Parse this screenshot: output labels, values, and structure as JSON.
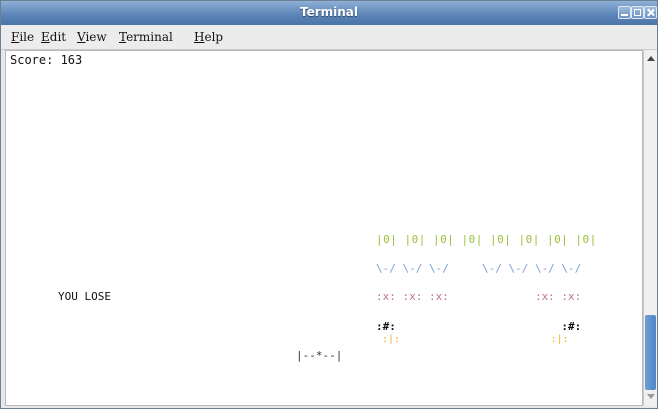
{
  "window": {
    "title": "Terminal"
  },
  "menu": {
    "items": [
      "File",
      "Edit",
      "View",
      "Terminal",
      "Help"
    ]
  },
  "game": {
    "score_line": "Score: 163",
    "message": "YOU LOSE",
    "invaders": {
      "row1": "|0| |0| |0| |0| |0| |0| |0| |0|",
      "row2": "\\-/ \\-/ \\-/     \\-/ \\-/ \\-/ \\-/",
      "row3": ":x: :x: :x:             :x: :x:",
      "row4": ":#:                         :#:",
      "row5": " :|:                         :|:"
    },
    "player": "|--*--|"
  },
  "colors": {
    "titlebar": "#5e86b8",
    "invader_green": "#9ac03a",
    "invader_blue": "#7a9fd4",
    "invader_pink": "#c17590",
    "invader_yellow": "#f0b22a",
    "scrollbar_thumb": "#4e86c5"
  },
  "icons": [
    "minimize-icon",
    "maximize-icon",
    "close-icon",
    "scroll-up-icon",
    "scroll-down-icon"
  ]
}
